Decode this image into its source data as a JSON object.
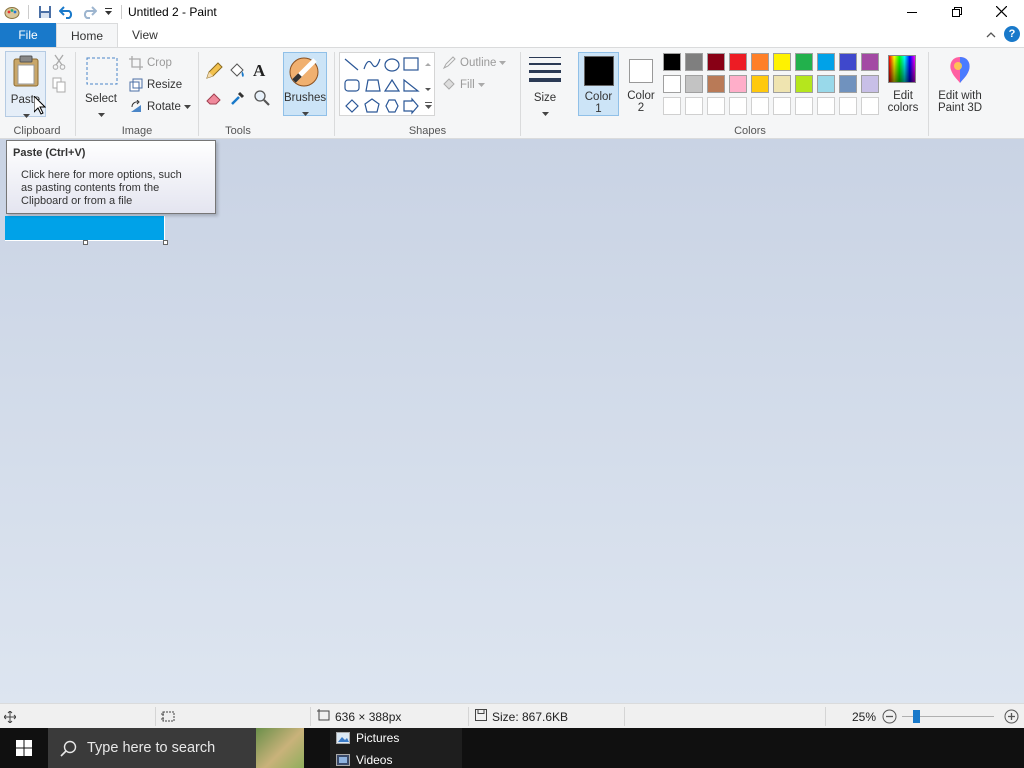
{
  "window": {
    "title": "Untitled 2 - Paint",
    "minimize_icon": "minimize-icon",
    "restore_icon": "restore-icon",
    "close_icon": "close-icon"
  },
  "tabs": {
    "file": "File",
    "home": "Home",
    "view": "View"
  },
  "ribbon": {
    "clipboard": {
      "paste": "Paste",
      "group": "Clipboard"
    },
    "image": {
      "select": "Select",
      "crop": "Crop",
      "resize": "Resize",
      "rotate": "Rotate",
      "group": "Image"
    },
    "tools": {
      "group": "Tools"
    },
    "brushes": {
      "label": "Brushes"
    },
    "shapes": {
      "outline": "Outline",
      "fill": "Fill",
      "group": "Shapes"
    },
    "size": {
      "label": "Size"
    },
    "colors": {
      "color1_a": "Color",
      "color1_b": "1",
      "color2_a": "Color",
      "color2_b": "2",
      "color1_value": "#000000",
      "color2_value": "#ffffff",
      "edit_a": "Edit",
      "edit_b": "colors",
      "paint3d_a": "Edit with",
      "paint3d_b": "Paint 3D",
      "group": "Colors",
      "palette_row1": [
        "#000000",
        "#7f7f7f",
        "#880015",
        "#ed1c24",
        "#ff7f27",
        "#fff200",
        "#22b14c",
        "#00a2e8",
        "#3f48cc",
        "#a349a4"
      ],
      "palette_row2": [
        "#ffffff",
        "#c3c3c3",
        "#b97a57",
        "#ffaec9",
        "#ffc90e",
        "#efe4b0",
        "#b5e61d",
        "#99d9ea",
        "#7092be",
        "#c8bfe7"
      ]
    }
  },
  "tooltip": {
    "title": "Paste (Ctrl+V)",
    "line1": "Click here for more options, such",
    "line2": "as pasting contents from the",
    "line3": "Clipboard or from a file"
  },
  "canvas": {
    "fill_color": "#00a2e8"
  },
  "status": {
    "dimensions": "636 × 388px",
    "size": "Size: 867.6KB",
    "zoom": "25%"
  },
  "taskbar": {
    "search_placeholder": "Type here to search",
    "jump_pictures": "Pictures",
    "jump_videos": "Videos"
  }
}
